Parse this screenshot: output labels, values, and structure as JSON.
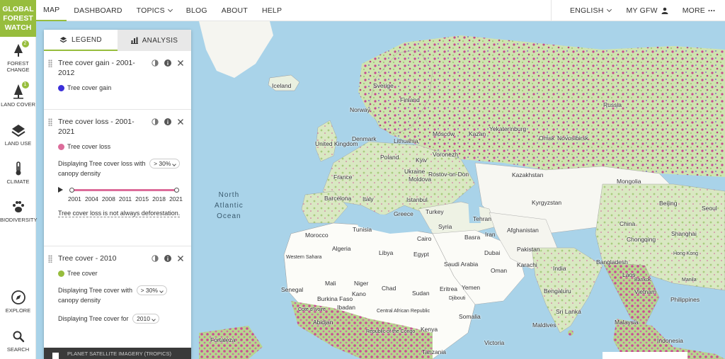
{
  "logo": {
    "line1": "GLOBAL",
    "line2": "FOREST",
    "line3": "WATCH"
  },
  "topnav": {
    "left": [
      "MAP",
      "DASHBOARD",
      "TOPICS",
      "BLOG",
      "ABOUT",
      "HELP"
    ],
    "language": "ENGLISH",
    "my_gfw": "MY GFW",
    "more": "MORE"
  },
  "sidebar": {
    "forest_change": {
      "label1": "FOREST",
      "label2": "CHANGE",
      "badge": "2"
    },
    "land_cover": {
      "label": "LAND COVER",
      "badge": "1"
    },
    "land_use": {
      "label": "LAND USE"
    },
    "climate": {
      "label": "CLIMATE"
    },
    "biodiversity": {
      "label": "BIODIVERSITY"
    },
    "explore": {
      "label": "EXPLORE"
    },
    "search": {
      "label": "SEARCH"
    }
  },
  "panel": {
    "tabs": {
      "legend": "LEGEND",
      "analysis": "ANALYSIS"
    },
    "layers": [
      {
        "title": "Tree cover gain - 2001-2012",
        "legend": "Tree cover gain",
        "color": "#3b2fd9"
      },
      {
        "title": "Tree cover loss - 2001-2021",
        "legend": "Tree cover loss",
        "color": "#dc6c9a",
        "param_prefix": "Displaying Tree cover loss with",
        "param_value": "> 30%",
        "param_suffix": "canopy density",
        "years": [
          "2001",
          "2004",
          "2008",
          "2011",
          "2015",
          "2018",
          "2021"
        ],
        "note": "Tree cover loss is not always deforestation."
      },
      {
        "title": "Tree cover - 2010",
        "legend": "Tree cover",
        "color": "#97bd3d",
        "param_prefix": "Displaying Tree cover with",
        "param_value": "> 30%",
        "param_suffix": "canopy density",
        "year_prefix": "Displaying Tree cover for",
        "year_value": "2010"
      }
    ],
    "footer": "PLANET SATELLITE IMAGERY (TROPICS)"
  },
  "map": {
    "ocean_label": {
      "line1": "North",
      "line2": "Atlantic",
      "line3": "Ocean"
    },
    "labels": [
      "Iceland",
      "Sverige",
      "Norway",
      "Finland",
      "Russia",
      "United Kingdom",
      "Denmark",
      "Poland",
      "Lithuania",
      "Moscow",
      "Kazan",
      "Yekaterinburg",
      "Omsk",
      "Novosibirsk",
      "Ukraine",
      "Voronezh",
      "France",
      "Kyiv",
      "Rostov-on-Don",
      "Kazakhstan",
      "Mongolia",
      "Moldova",
      "Barcelona",
      "Italy",
      "Istanbul",
      "Greece",
      "Turkey",
      "Kyrgyzstan",
      "Beijing",
      "Seoul",
      "Tunisia",
      "Morocco",
      "Syria",
      "Tehran",
      "Iran",
      "Basra",
      "Afghanistan",
      "Algeria",
      "Libya",
      "Egypt",
      "Cairo",
      "Dubai",
      "Pakistan",
      "China",
      "Shanghai",
      "Chongqing",
      "Saudi Arabia",
      "Oman",
      "Karachi",
      "India",
      "Bangladesh",
      "Laos",
      "Mali",
      "Niger",
      "Chad",
      "Sudan",
      "Senegal",
      "Burkina Faso",
      "Kano",
      "Eritrea",
      "Yemen",
      "Bengaluru",
      "Vietnam",
      "Philippines",
      "Abidjan",
      "Ibadan",
      "Somalia",
      "Sri Lanka",
      "Maldives",
      "Malaysia",
      "Indonesia",
      "Fortaleza",
      "Tanzania",
      "Victoria",
      "Republic of the Congo",
      "Kenya",
      "Western Sahara",
      "Cote d'Ivoire",
      "Central African Republic",
      "Djibouti",
      "Hong Kong",
      "Bankok",
      "Manila"
    ]
  }
}
